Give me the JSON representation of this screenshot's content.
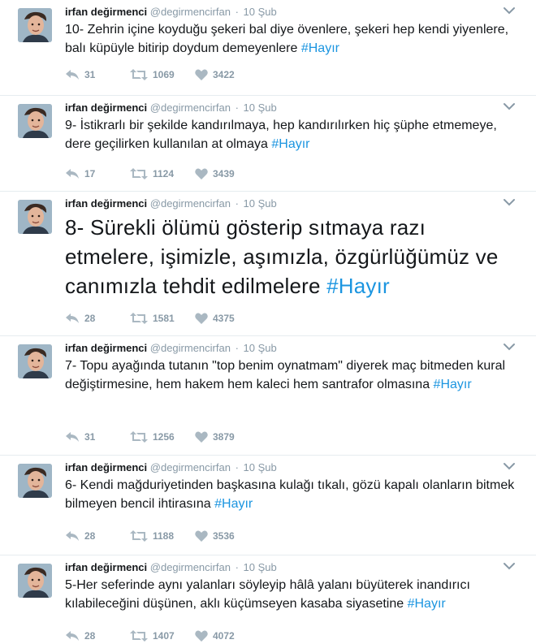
{
  "tweets": [
    {
      "name": "irfan değirmenci",
      "handle": "@degirmencirfan",
      "date": "10 Şub",
      "text": "10- Zehrin içine koyduğu şekeri bal diye övenlere, şekeri hep kendi yiyenlere, balı küpüyle bitirip doydum demeyenlere",
      "hashtag": "#Hayır",
      "replies": "31",
      "retweets": "1069",
      "likes": "3422"
    },
    {
      "name": "irfan değirmenci",
      "handle": "@degirmencirfan",
      "date": "10 Şub",
      "text": "9- İstikrarlı bir şekilde kandırılmaya, hep kandırılırken hiç şüphe etmemeye, dere geçilirken kullanılan at olmaya",
      "hashtag": "#Hayır",
      "replies": "17",
      "retweets": "1124",
      "likes": "3439"
    },
    {
      "name": "irfan değirmenci",
      "handle": "@degirmencirfan",
      "date": "10 Şub",
      "text": "8- Sürekli ölümü gösterip sıtmaya razı etmelere, işimizle, aşımızla, özgürlüğümüz ve canımızla tehdit edilmelere",
      "hashtag": "#Hayır",
      "replies": "28",
      "retweets": "1581",
      "likes": "4375"
    },
    {
      "name": "irfan değirmenci",
      "handle": "@degirmencirfan",
      "date": "10 Şub",
      "text": "7- Topu ayağında tutanın \"top benim oynatmam\" diyerek maç bitmeden kural değiştirmesine, hem hakem hem kaleci hem santrafor olmasına",
      "hashtag": "#Hayır",
      "replies": "31",
      "retweets": "1256",
      "likes": "3879"
    },
    {
      "name": "irfan değirmenci",
      "handle": "@degirmencirfan",
      "date": "10 Şub",
      "text": "6- Kendi mağduriyetinden başkasına kulağı tıkalı, gözü kapalı olanların bitmek bilmeyen bencil ihtirasına",
      "hashtag": "#Hayır",
      "replies": "28",
      "retweets": "1188",
      "likes": "3536"
    },
    {
      "name": "irfan değirmenci",
      "handle": "@degirmencirfan",
      "date": "10 Şub",
      "text": "5-Her seferinde aynı yalanları söyleyip hâlâ yalanı büyüterek inandırıcı kılabileceğini düşünen, aklı küçümseyen kasaba siyasetine",
      "hashtag": "#Hayır",
      "replies": "28",
      "retweets": "1407",
      "likes": "4072"
    }
  ],
  "icons": {
    "reply": "reply-icon",
    "retweet": "retweet-icon",
    "like": "heart-icon",
    "menu": "chevron-down-icon"
  },
  "colors": {
    "hashtag": "#1b95e0",
    "muted": "#8899a6",
    "text": "#14171a",
    "divider": "#e6ecf0"
  }
}
